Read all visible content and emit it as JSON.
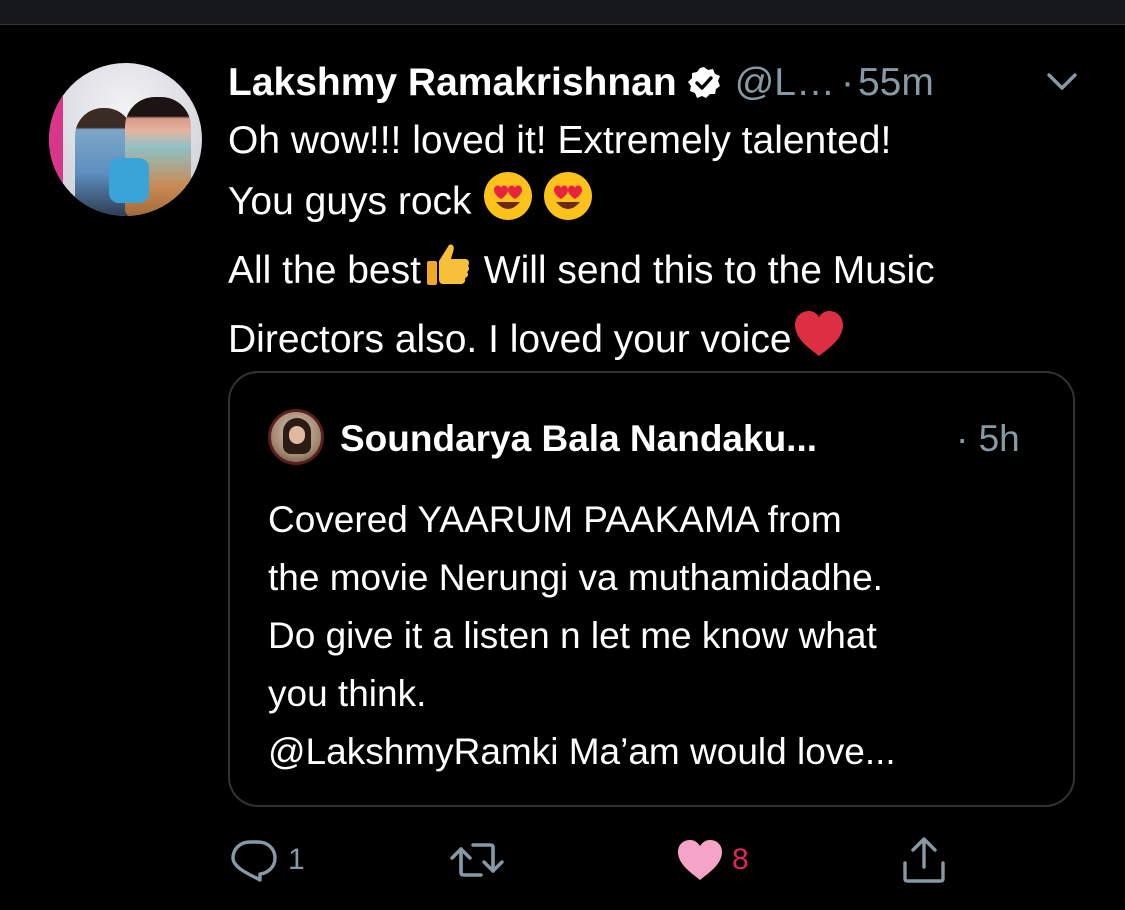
{
  "tweet": {
    "author_name": "Lakshmy Ramakrishnan",
    "handle": "@L…",
    "separator": "·",
    "time_ago": "55m",
    "text_line1": "Oh wow!!! loved it! Extremely talented!",
    "text_line2_prefix": "You guys rock ",
    "text_line3_prefix": "All the best",
    "text_line3_suffix": " Will send this to the Music",
    "text_line4": "Directors also. I loved your voice",
    "emoji_names": [
      "heart-eyes-emoji",
      "heart-eyes-emoji",
      "thumbs-up-emoji",
      "red-heart-emoji"
    ]
  },
  "quoted_tweet": {
    "author_name": "Soundarya Bala Nandaku...",
    "time_ago": "· 5h",
    "text": "Covered YAARUM PAAKAMA from\nthe movie Nerungi va muthamidadhe.\nDo give it a listen n let me know what\nyou think.\n@LakshmyRamki Ma’am would love..."
  },
  "actions": {
    "reply_count": "1",
    "like_count": "8"
  },
  "colors": {
    "background": "#000000",
    "text_primary": "#ffffff",
    "text_secondary": "#8899a6",
    "like": "#e0245e",
    "like_fill": "#f5a3c7",
    "border": "#2f3336"
  },
  "icons": {
    "verified": "verified-badge-icon",
    "menu": "chevron-down-icon",
    "reply": "reply-icon",
    "retweet": "retweet-icon",
    "like": "heart-icon",
    "share": "share-icon"
  }
}
